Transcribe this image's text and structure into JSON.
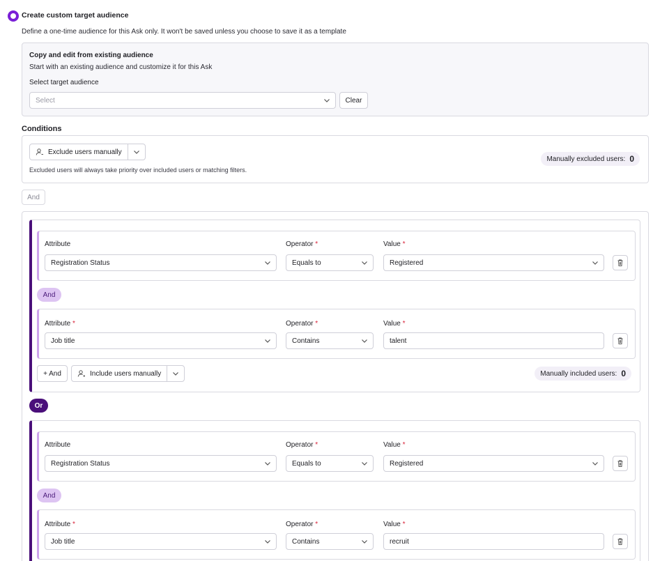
{
  "header": {
    "title": "Create custom target audience",
    "subtitle": "Define a one-time audience for this Ask only. It won't be saved unless you choose to save it as a template"
  },
  "copy_section": {
    "title": "Copy and edit from existing audience",
    "subtitle": "Start with an existing audience and customize it for this Ask",
    "select_label": "Select target audience",
    "select_placeholder": "Select",
    "clear_label": "Clear"
  },
  "conditions": {
    "title": "Conditions",
    "exclude_button": "Exclude users manually",
    "excluded_label": "Manually excluded users:",
    "excluded_count": "0",
    "note": "Excluded users will always take priority over included users or matching filters.",
    "and_connector": "And"
  },
  "labels": {
    "attribute": "Attribute",
    "operator": "Operator",
    "value": "Value",
    "required_mark": "*",
    "and": "And",
    "or": "Or",
    "add_and": "+ And",
    "include_manually": "Include users manually",
    "included_label": "Manually included users:"
  },
  "groups": [
    {
      "included_count": "0",
      "rules": [
        {
          "attribute": "Registration Status",
          "operator": "Equals to",
          "value": "Registered",
          "value_type": "select"
        },
        {
          "attribute": "Job title",
          "operator": "Contains",
          "value": "talent",
          "value_type": "text"
        }
      ]
    },
    {
      "rules": [
        {
          "attribute": "Registration Status",
          "operator": "Equals to",
          "value": "Registered",
          "value_type": "select"
        },
        {
          "attribute": "Job title",
          "operator": "Contains",
          "value": "recruit",
          "value_type": "text"
        }
      ]
    }
  ]
}
